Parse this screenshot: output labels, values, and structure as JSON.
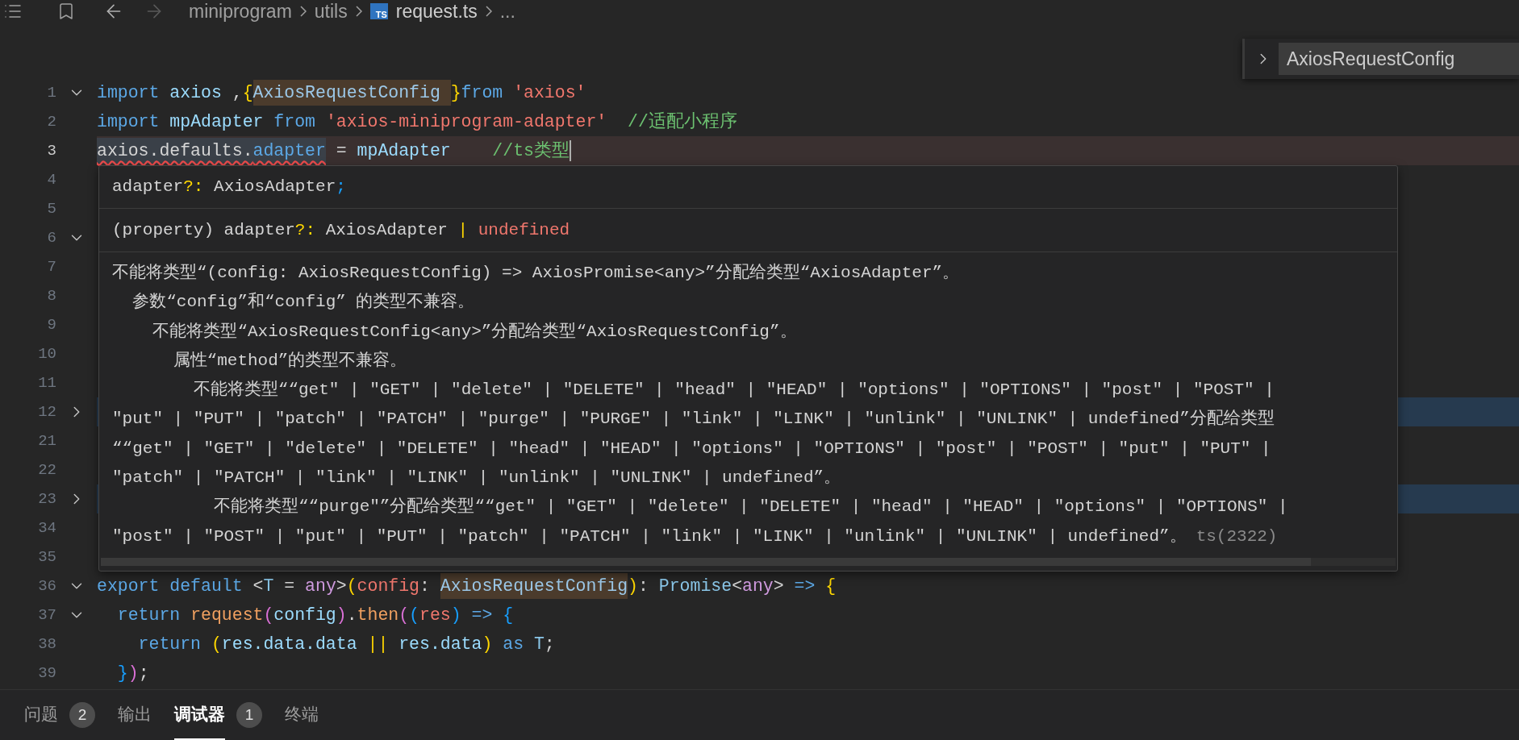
{
  "toolbar": {
    "navigation": [
      {
        "kind": "back",
        "disabled": false
      },
      {
        "kind": "forward",
        "disabled": true
      }
    ],
    "breadcrumbs": [
      {
        "text": "miniprogram"
      },
      {
        "text": "utils"
      },
      {
        "text": "request.ts",
        "badge": "TS"
      },
      {
        "text": "..."
      }
    ]
  },
  "find_widget": {
    "value": "AxiosRequestConfig"
  },
  "editor": {
    "lines": [
      {
        "number": "1",
        "collapsed": false,
        "current": false,
        "tokens": [
          {
            "kind": "keyword",
            "text": "import"
          },
          {
            "kind": "variable",
            "text": " axios "
          },
          {
            "kind": "plain",
            "text": ","
          },
          {
            "kind": "bracket-gold",
            "text": "{"
          },
          {
            "kind": "match",
            "text": "AxiosRequestConfig "
          },
          {
            "kind": "bracket-gold",
            "text": "}"
          },
          {
            "kind": "keyword",
            "text": "from "
          },
          {
            "kind": "string",
            "text": "'axios'"
          }
        ]
      },
      {
        "number": "2",
        "current": false,
        "tokens": [
          {
            "kind": "keyword",
            "text": "import"
          },
          {
            "kind": "variable",
            "text": " mpAdapter "
          },
          {
            "kind": "keyword",
            "text": "from "
          },
          {
            "kind": "string",
            "text": "'axios-miniprogram-adapter'"
          },
          {
            "kind": "comment",
            "text": "  //适配小程序"
          }
        ]
      },
      {
        "number": "3",
        "current": true,
        "tokens": [
          {
            "kind": "error",
            "text": "axios.defaults."
          },
          {
            "kind": "error-property",
            "text": "adapter"
          },
          {
            "kind": "plain",
            "text": " = "
          },
          {
            "kind": "variable",
            "text": "mpAdapter"
          },
          {
            "kind": "comment",
            "text": "    //ts类型"
          }
        ]
      },
      {
        "number": "4",
        "current": false
      },
      {
        "number": "5",
        "current": false
      },
      {
        "number": "6",
        "collapsed": false,
        "current": false
      },
      {
        "number": "7",
        "current": false
      },
      {
        "number": "8",
        "current": false
      },
      {
        "number": "9",
        "current": false
      },
      {
        "number": "10",
        "current": false
      },
      {
        "number": "11",
        "current": false
      },
      {
        "number": "12",
        "collapsed": true,
        "current": false
      },
      {
        "number": "21",
        "current": false
      },
      {
        "number": "22",
        "current": false
      },
      {
        "number": "23",
        "collapsed": true,
        "current": false
      },
      {
        "number": "34",
        "current": false
      },
      {
        "number": "35",
        "current": false
      },
      {
        "number": "36",
        "collapsed": false,
        "current": false,
        "tokens": [
          {
            "kind": "keyword",
            "text": "export default "
          },
          {
            "kind": "plain",
            "text": "<"
          },
          {
            "kind": "type",
            "text": "T"
          },
          {
            "kind": "plain",
            "text": " = "
          },
          {
            "kind": "any",
            "text": "any"
          },
          {
            "kind": "plain",
            "text": ">"
          },
          {
            "kind": "bracket-gold",
            "text": "("
          },
          {
            "kind": "param",
            "text": "config"
          },
          {
            "kind": "plain",
            "text": ": "
          },
          {
            "kind": "match",
            "text": "AxiosRequestConfig"
          },
          {
            "kind": "bracket-gold",
            "text": ")"
          },
          {
            "kind": "plain",
            "text": ": "
          },
          {
            "kind": "type",
            "text": "Promise"
          },
          {
            "kind": "plain",
            "text": "<"
          },
          {
            "kind": "any",
            "text": "any"
          },
          {
            "kind": "plain",
            "text": "> "
          },
          {
            "kind": "keyword",
            "text": "=> "
          },
          {
            "kind": "bracket-gold",
            "text": "{"
          }
        ]
      },
      {
        "number": "37",
        "collapsed": false,
        "current": false,
        "tokens": [
          {
            "kind": "keyword",
            "text": "  return "
          },
          {
            "kind": "function",
            "text": "request"
          },
          {
            "kind": "bracket-purple",
            "text": "("
          },
          {
            "kind": "variable",
            "text": "config"
          },
          {
            "kind": "bracket-purple",
            "text": ")"
          },
          {
            "kind": "plain",
            "text": "."
          },
          {
            "kind": "function",
            "text": "then"
          },
          {
            "kind": "bracket-purple",
            "text": "("
          },
          {
            "kind": "bracket-blue",
            "text": "("
          },
          {
            "kind": "param",
            "text": "res"
          },
          {
            "kind": "bracket-blue",
            "text": ")"
          },
          {
            "kind": "keyword",
            "text": " => "
          },
          {
            "kind": "bracket-blue",
            "text": "{"
          }
        ]
      },
      {
        "number": "38",
        "current": false,
        "tokens": [
          {
            "kind": "keyword",
            "text": "    return "
          },
          {
            "kind": "bracket-gold",
            "text": "("
          },
          {
            "kind": "variable",
            "text": "res.data.data "
          },
          {
            "kind": "bracket-gold",
            "text": "||"
          },
          {
            "kind": "variable",
            "text": " res.data"
          },
          {
            "kind": "bracket-gold",
            "text": ")"
          },
          {
            "kind": "keyword",
            "text": " as "
          },
          {
            "kind": "type",
            "text": "T"
          },
          {
            "kind": "plain",
            "text": ";"
          }
        ]
      },
      {
        "number": "39",
        "current": false,
        "tokens": [
          {
            "kind": "bracket-blue",
            "text": "  }"
          },
          {
            "kind": "bracket-purple",
            "text": ")"
          },
          {
            "kind": "plain",
            "text": ";"
          }
        ]
      }
    ]
  },
  "hover": {
    "declaration": [
      {
        "kind": "plain",
        "text": "adapter"
      },
      {
        "kind": "operator",
        "text": "?:"
      },
      {
        "kind": "plain",
        "text": " AxiosAdapter"
      },
      {
        "kind": "punct",
        "text": ";"
      }
    ],
    "signature": [
      {
        "kind": "plain",
        "text": "(property) adapter"
      },
      {
        "kind": "operator",
        "text": "?:"
      },
      {
        "kind": "plain",
        "text": " AxiosAdapter "
      },
      {
        "kind": "operator",
        "text": "| "
      },
      {
        "kind": "undefined",
        "text": "undefined"
      }
    ],
    "message": [
      "不能将类型“(config: AxiosRequestConfig) => AxiosPromise<any>”分配给类型“AxiosAdapter”。",
      "  参数“config”和“config” 的类型不兼容。",
      "    不能将类型“AxiosRequestConfig<any>”分配给类型“AxiosRequestConfig”。",
      "      属性“method”的类型不兼容。",
      "        不能将类型““get\" | \"GET\" | \"delete\" | \"DELETE\" | \"head\" | \"HEAD\" | \"options\" | \"OPTIONS\" | \"post\" | \"POST\" |",
      "\"put\" | \"PUT\" | \"patch\" | \"PATCH\" | \"purge\" | \"PURGE\" | \"link\" | \"LINK\" | \"unlink\" | \"UNLINK\" | undefined”分配给类型",
      "““get\" | \"GET\" | \"delete\" | \"DELETE\" | \"head\" | \"HEAD\" | \"options\" | \"OPTIONS\" | \"post\" | \"POST\" | \"put\" | \"PUT\" |",
      "\"patch\" | \"PATCH\" | \"link\" | \"LINK\" | \"unlink\" | \"UNLINK\" | undefined”。",
      "          不能将类型““purge\"”分配给类型““get\" | \"GET\" | \"delete\" | \"DELETE\" | \"head\" | \"HEAD\" | \"options\" | \"OPTIONS\" |",
      "\"post\" | \"POST\" | \"put\" | \"PUT\" | \"patch\" | \"PATCH\" | \"link\" | \"LINK\" | \"unlink\" | \"UNLINK\" | undefined”。"
    ],
    "error_code": "ts(2322)"
  },
  "panel_tabs": [
    {
      "label": "问题",
      "count": "2",
      "selected": false
    },
    {
      "label": "输出",
      "selected": false
    },
    {
      "label": "调试器",
      "count": "1",
      "selected": true
    },
    {
      "label": "终端",
      "selected": false
    }
  ]
}
